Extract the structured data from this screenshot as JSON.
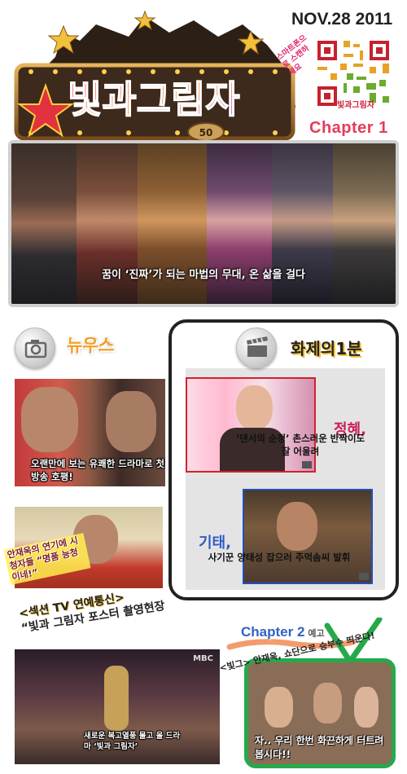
{
  "header": {
    "date": "NOV.28 2011",
    "logo_text": "빛과그림자",
    "logo_badge": "50",
    "qr_label": "빛과그림자",
    "mobile_text": "스마트폰으로 스캔하세요",
    "chapter": "Chapter 1"
  },
  "banner": {
    "caption": "꿈이 ‘진짜’가 되는 마법의 무대, 온 삶을 걸다"
  },
  "news": {
    "title": "뉴우스",
    "item1_caption": "오랜만에 보는 유쾌한 드라마로 첫방송 호평!",
    "item2_caption": "안재욱의 연기에 시청자들 “명품 능청이네!”"
  },
  "topic": {
    "title": "화제의1분",
    "item1_name": "정혜,",
    "item1_caption": "‘댄서의 순정’ 촌스러운 반짝이도 잘 어울려",
    "item2_name": "기태,",
    "item2_caption": "사기꾼 양태성 잡으러 주먹솜씨 발휘"
  },
  "bottom": {
    "show_title_line1": "<섹션 TV 연예통신>",
    "show_title_line2": "“빛과 그림자 포스터 촬영현장",
    "video_caption": "새로운 복고열풍 몰고 올 드라마 ‘빛과 그림자’",
    "broadcaster": "MBC",
    "chapter2": "Chapter 2",
    "chapter2_suffix": "예고",
    "chapter2_teaser": "<빛그> 안재욱, 쇼단으로 승부수 띄운다!",
    "chapter2_caption": "자.. 우리 한번 화끈하게 터트려 봅시다!!"
  },
  "colors": {
    "accent_orange": "#f4a021",
    "chapter1_pink": "#e43c5a",
    "chapter2_blue": "#2f63c4",
    "frame_green": "#27a94a"
  }
}
